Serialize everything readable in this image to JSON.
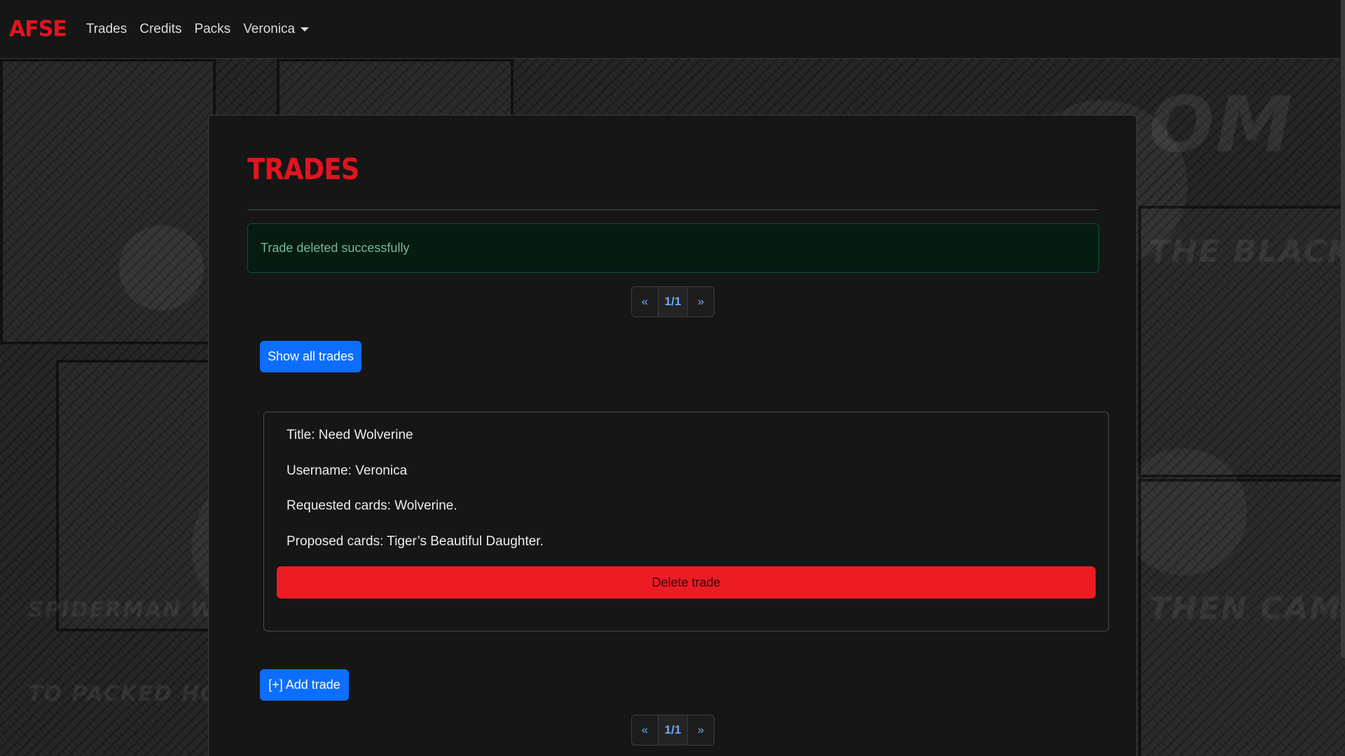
{
  "navbar": {
    "brand": "AFSE",
    "links": [
      "Trades",
      "Credits",
      "Packs"
    ],
    "user": "Veronica"
  },
  "page": {
    "title": "TRADES",
    "alert": "Trade deleted successfully"
  },
  "pagination": {
    "prev": "«",
    "current": "1/1",
    "next": "»"
  },
  "buttons": {
    "show_all": "Show all trades",
    "add_trade": "[+] Add trade",
    "delete": "Delete trade"
  },
  "trade": {
    "title": "Title: Need Wolverine",
    "username": "Username: Veronica",
    "requested": "Requested cards: Wolverine.",
    "proposed": "Proposed cards: Tiger’s Beautiful Daughter."
  },
  "colors": {
    "brand_red": "#e3131f",
    "primary_blue": "#0d6efd",
    "danger_red": "#ed1c24",
    "success_text": "#75b798"
  }
}
